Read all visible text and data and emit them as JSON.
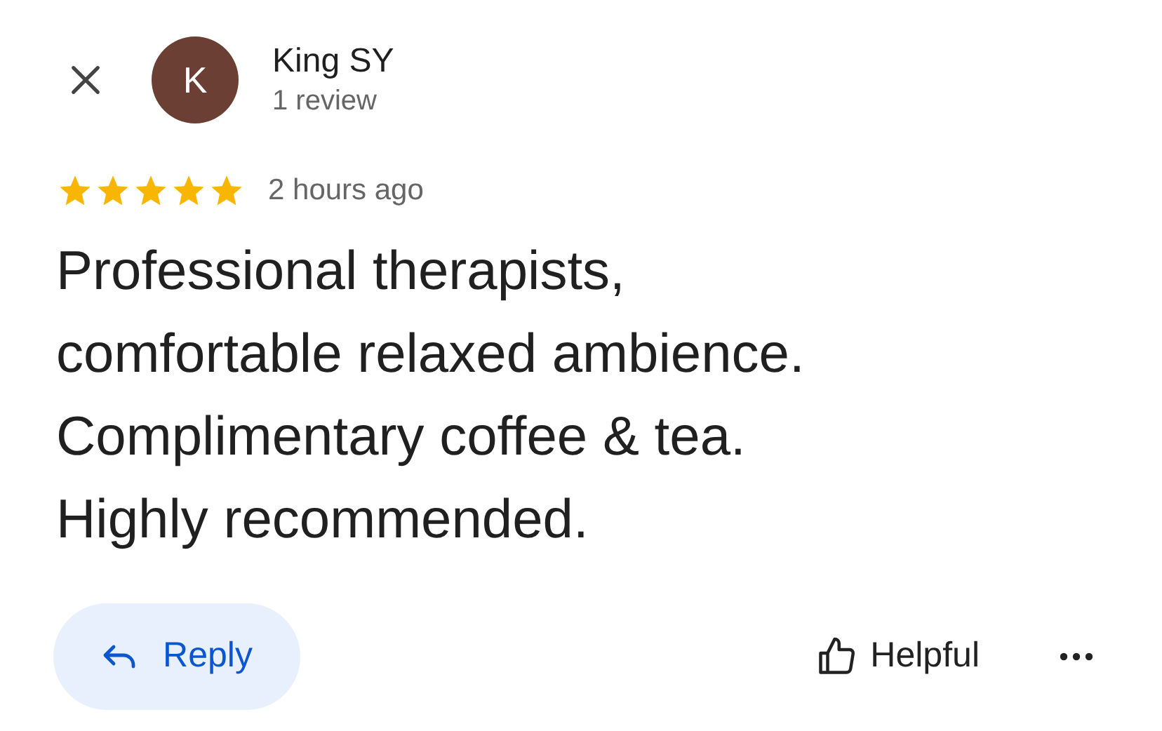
{
  "reviewer": {
    "initial": "K",
    "name": "King SY",
    "reviews": "1 review"
  },
  "review": {
    "stars": 5,
    "time": "2 hours ago",
    "text": "Professional therapists,\ncomfortable relaxed ambience.\nComplimentary coffee & tea.\nHighly recommended."
  },
  "actions": {
    "reply": "Reply",
    "helpful": "Helpful"
  }
}
